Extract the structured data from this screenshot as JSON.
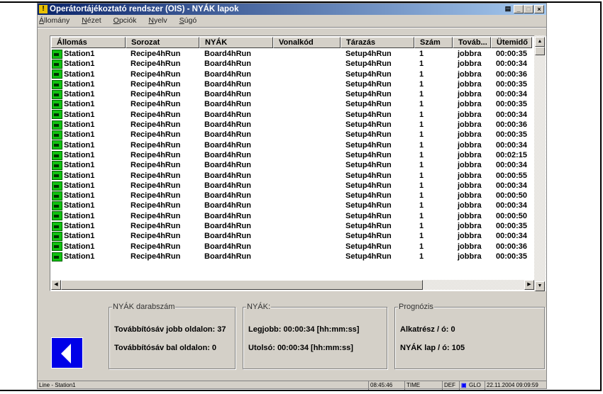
{
  "window": {
    "title": "Operátortájékoztató rendszer (OIS) - NYÁK lapok"
  },
  "menu": [
    "Állomány",
    "Nézet",
    "Opciók",
    "Nyelv",
    "Súgó"
  ],
  "table": {
    "columns": [
      "Állomás",
      "Sorozat",
      "NYÁK",
      "Vonalkód",
      "Tárazás",
      "Szám",
      "Továb...",
      "Ütemidő"
    ],
    "rows": [
      [
        "Station1",
        "Recipe4hRun",
        "Board4hRun",
        "",
        "Setup4hRun",
        "1",
        "jobbra",
        "00:00:35"
      ],
      [
        "Station1",
        "Recipe4hRun",
        "Board4hRun",
        "",
        "Setup4hRun",
        "1",
        "jobbra",
        "00:00:34"
      ],
      [
        "Station1",
        "Recipe4hRun",
        "Board4hRun",
        "",
        "Setup4hRun",
        "1",
        "jobbra",
        "00:00:36"
      ],
      [
        "Station1",
        "Recipe4hRun",
        "Board4hRun",
        "",
        "Setup4hRun",
        "1",
        "jobbra",
        "00:00:35"
      ],
      [
        "Station1",
        "Recipe4hRun",
        "Board4hRun",
        "",
        "Setup4hRun",
        "1",
        "jobbra",
        "00:00:34"
      ],
      [
        "Station1",
        "Recipe4hRun",
        "Board4hRun",
        "",
        "Setup4hRun",
        "1",
        "jobbra",
        "00:00:35"
      ],
      [
        "Station1",
        "Recipe4hRun",
        "Board4hRun",
        "",
        "Setup4hRun",
        "1",
        "jobbra",
        "00:00:34"
      ],
      [
        "Station1",
        "Recipe4hRun",
        "Board4hRun",
        "",
        "Setup4hRun",
        "1",
        "jobbra",
        "00:00:36"
      ],
      [
        "Station1",
        "Recipe4hRun",
        "Board4hRun",
        "",
        "Setup4hRun",
        "1",
        "jobbra",
        "00:00:35"
      ],
      [
        "Station1",
        "Recipe4hRun",
        "Board4hRun",
        "",
        "Setup4hRun",
        "1",
        "jobbra",
        "00:00:34"
      ],
      [
        "Station1",
        "Recipe4hRun",
        "Board4hRun",
        "",
        "Setup4hRun",
        "1",
        "jobbra",
        "00:02:15"
      ],
      [
        "Station1",
        "Recipe4hRun",
        "Board4hRun",
        "",
        "Setup4hRun",
        "1",
        "jobbra",
        "00:00:34"
      ],
      [
        "Station1",
        "Recipe4hRun",
        "Board4hRun",
        "",
        "Setup4hRun",
        "1",
        "jobbra",
        "00:00:55"
      ],
      [
        "Station1",
        "Recipe4hRun",
        "Board4hRun",
        "",
        "Setup4hRun",
        "1",
        "jobbra",
        "00:00:34"
      ],
      [
        "Station1",
        "Recipe4hRun",
        "Board4hRun",
        "",
        "Setup4hRun",
        "1",
        "jobbra",
        "00:00:50"
      ],
      [
        "Station1",
        "Recipe4hRun",
        "Board4hRun",
        "",
        "Setup4hRun",
        "1",
        "jobbra",
        "00:00:34"
      ],
      [
        "Station1",
        "Recipe4hRun",
        "Board4hRun",
        "",
        "Setup4hRun",
        "1",
        "jobbra",
        "00:00:50"
      ],
      [
        "Station1",
        "Recipe4hRun",
        "Board4hRun",
        "",
        "Setup4hRun",
        "1",
        "jobbra",
        "00:00:35"
      ],
      [
        "Station1",
        "Recipe4hRun",
        "Board4hRun",
        "",
        "Setup4hRun",
        "1",
        "jobbra",
        "00:00:34"
      ],
      [
        "Station1",
        "Recipe4hRun",
        "Board4hRun",
        "",
        "Setup4hRun",
        "1",
        "jobbra",
        "00:00:36"
      ],
      [
        "Station1",
        "Recipe4hRun",
        "Board4hRun",
        "",
        "Setup4hRun",
        "1",
        "jobbra",
        "00:00:35"
      ]
    ]
  },
  "groups": {
    "count": {
      "title": "NYÁK darabszám",
      "right": "Továbbítósáv jobb oldalon: 37",
      "left": "Továbbítósáv bal oldalon: 0"
    },
    "pcb": {
      "title": "NYÁK:",
      "best": "Legjobb: 00:00:34 [hh:mm:ss]",
      "last": "Utolsó: 00:00:34 [hh:mm:ss]"
    },
    "forecast": {
      "title": "Prognózis",
      "parts": "Alkatrész / ó: 0",
      "boards": "NYÁK lap / ó: 105"
    }
  },
  "status": {
    "line": "Line - Station1",
    "time": "08:45:46",
    "mode": "TIME",
    "def": "DEF",
    "glo": "GLO",
    "datetime": "22.11.2004 09:09:59"
  },
  "colors": {
    "back_button": "#0000e8",
    "station_icon": "#10c010"
  }
}
